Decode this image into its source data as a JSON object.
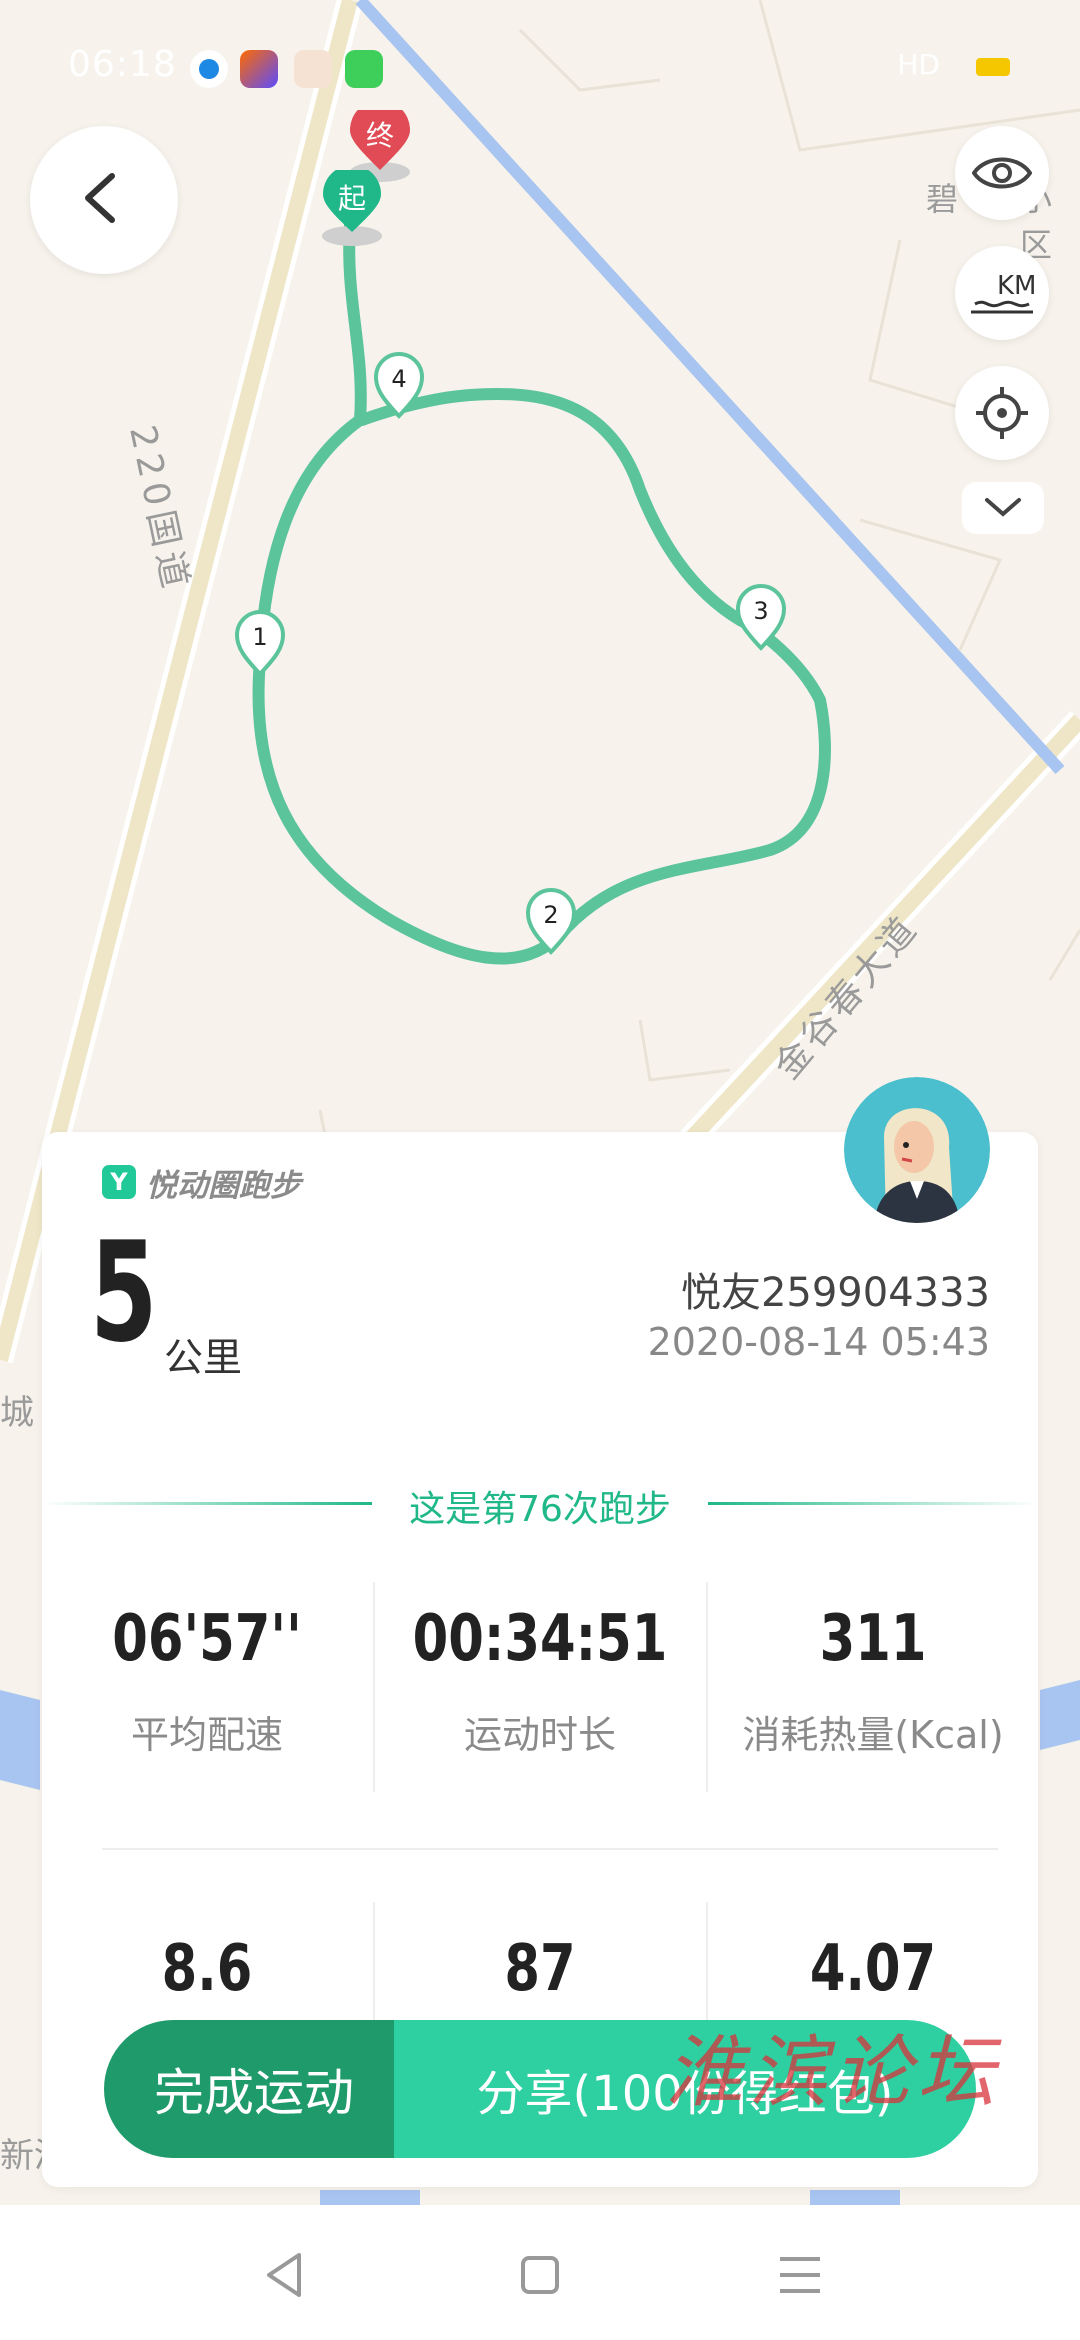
{
  "status_bar": {
    "time": "06:18",
    "network": "HD",
    "signal": "‧∥∥"
  },
  "map": {
    "labels": {
      "road_220": "220国道",
      "avenue": "金谷春大道",
      "community": "碧",
      "community_tail": "小区",
      "city_left": "城",
      "xinhuai": "新淮"
    },
    "markers": {
      "start": "起",
      "end": "终",
      "km1": "1",
      "km2": "2",
      "km3": "3",
      "km4": "4"
    }
  },
  "controls": {
    "eye": "eye-icon",
    "km": "KM",
    "locate": "locate-icon",
    "collapse": "chevron-down-icon"
  },
  "card": {
    "brand": "悦动圈跑步",
    "distance": "5",
    "distance_unit": "公里",
    "user_name": "悦友259904333",
    "date": "2020-08-14 05:43",
    "run_count_text": "这是第76次跑步",
    "stats": [
      {
        "value": "06'57''",
        "label": "平均配速"
      },
      {
        "value": "00:34:51",
        "label": "运动时长"
      },
      {
        "value": "311",
        "label": "消耗热量(Kcal)"
      },
      {
        "value": "8.6",
        "label": ""
      },
      {
        "value": "87",
        "label": ""
      },
      {
        "value": "4.07",
        "label": ""
      }
    ]
  },
  "actions": {
    "finish": "完成运动",
    "share": "分享(100份得红包)"
  },
  "watermark": "淮滨论坛",
  "colors": {
    "route": "#5cc49a",
    "accent": "#20c997",
    "finish": "#1f9a6b",
    "share": "#2ecfa0",
    "end_marker": "#e04b55"
  }
}
